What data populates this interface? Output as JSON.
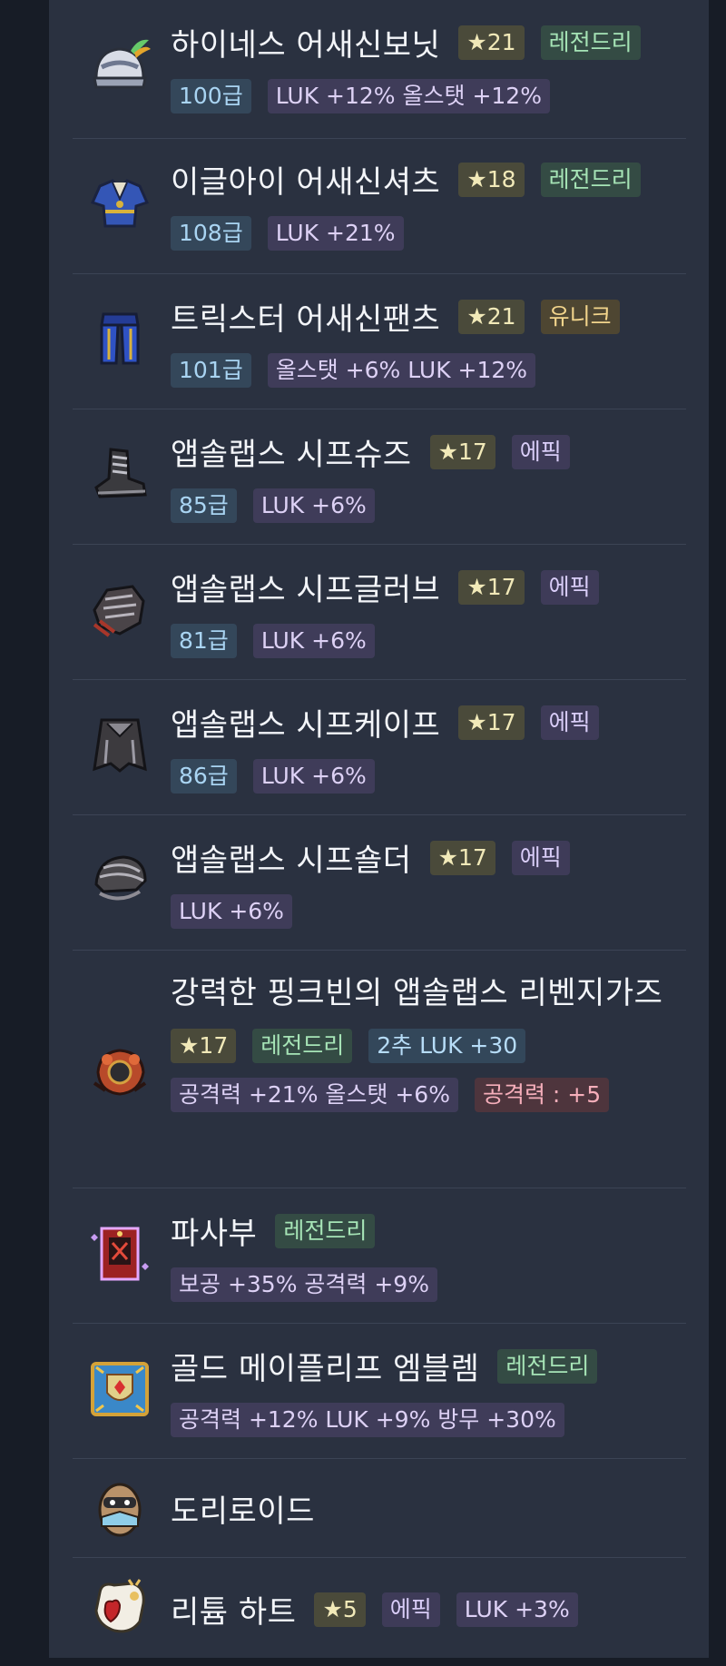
{
  "items": [
    {
      "name": "하이네스 어새신보닛",
      "star": "★21",
      "grade": "레전드리",
      "gradeType": "legend",
      "level": "100급",
      "stats": [
        "LUK +12% 올스탯 +12%"
      ],
      "icon": "helmet-icon"
    },
    {
      "name": "이글아이 어새신셔츠",
      "star": "★18",
      "grade": "레전드리",
      "gradeType": "legend",
      "level": "108급",
      "stats": [
        "LUK +21%"
      ],
      "icon": "shirt-icon"
    },
    {
      "name": "트릭스터 어새신팬츠",
      "star": "★21",
      "grade": "유니크",
      "gradeType": "unique",
      "level": "101급",
      "stats": [
        "올스탯 +6% LUK +12%"
      ],
      "icon": "pants-icon"
    },
    {
      "name": "앱솔랩스 시프슈즈",
      "star": "★17",
      "grade": "에픽",
      "gradeType": "epic",
      "level": "85급",
      "stats": [
        "LUK +6%"
      ],
      "icon": "shoes-icon"
    },
    {
      "name": "앱솔랩스 시프글러브",
      "star": "★17",
      "grade": "에픽",
      "gradeType": "epic",
      "level": "81급",
      "stats": [
        "LUK +6%"
      ],
      "icon": "gloves-icon"
    },
    {
      "name": "앱솔랩스 시프케이프",
      "star": "★17",
      "grade": "에픽",
      "gradeType": "epic",
      "level": "86급",
      "stats": [
        "LUK +6%"
      ],
      "icon": "cape-icon"
    },
    {
      "name": "앱솔랩스 시프숄더",
      "star": "★17",
      "grade": "에픽",
      "gradeType": "epic",
      "stats": [
        "LUK +6%"
      ],
      "icon": "shoulder-icon"
    },
    {
      "name": "강력한 핑크빈의 앱솔랩스 리벤지가즈",
      "star": "★17",
      "grade": "레전드리",
      "gradeType": "legend",
      "addl": "2추 LUK +30",
      "stats": [
        "공격력 +21% 올스탯 +6%"
      ],
      "extra": "공격력 : +5",
      "icon": "secondary-weapon-icon"
    },
    {
      "name": "파사부",
      "grade": "레전드리",
      "gradeType": "legend",
      "stats": [
        "보공 +35% 공격력 +9%"
      ],
      "icon": "talisman-icon"
    },
    {
      "name": "골드 메이플리프 엠블렘",
      "grade": "레전드리",
      "gradeType": "legend",
      "stats": [
        "공격력 +12% LUK +9% 방무 +30%"
      ],
      "icon": "emblem-icon"
    },
    {
      "name": "도리로이드",
      "icon": "android-icon"
    },
    {
      "name": "리튬 하트",
      "star": "★5",
      "grade": "에픽",
      "gradeType": "epic",
      "stats": [
        "LUK +3%"
      ],
      "icon": "heart-icon"
    }
  ],
  "colors": {
    "background": "#171c26",
    "panel": "#2a3140",
    "legendary": "#a6e4b6",
    "unique": "#f3d58c",
    "epic": "#d9cdf8",
    "star": "#f4d648"
  }
}
